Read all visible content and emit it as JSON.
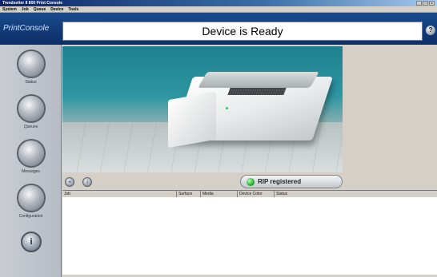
{
  "window": {
    "title": "Trendsetter II 800 Print Console",
    "controls": [
      "_",
      "□",
      "×"
    ]
  },
  "menu": {
    "items": [
      "System",
      "Job",
      "Queue",
      "Device",
      "Tools"
    ]
  },
  "header": {
    "brand": "PrintConsole",
    "status_message": "Device is Ready",
    "help_icon_glyph": "?"
  },
  "sidebar": {
    "items": [
      {
        "label": "Status"
      },
      {
        "label": "Queues"
      },
      {
        "label": "Messages"
      },
      {
        "label": "Configuration"
      }
    ],
    "info_glyph": "i"
  },
  "toolbar": {
    "rip_status": "RIP registered",
    "rip_status_color": "#23b02d"
  },
  "job_table": {
    "columns": [
      "Job",
      "Surface",
      "Media",
      "Device Color",
      "Status"
    ],
    "rows": []
  }
}
